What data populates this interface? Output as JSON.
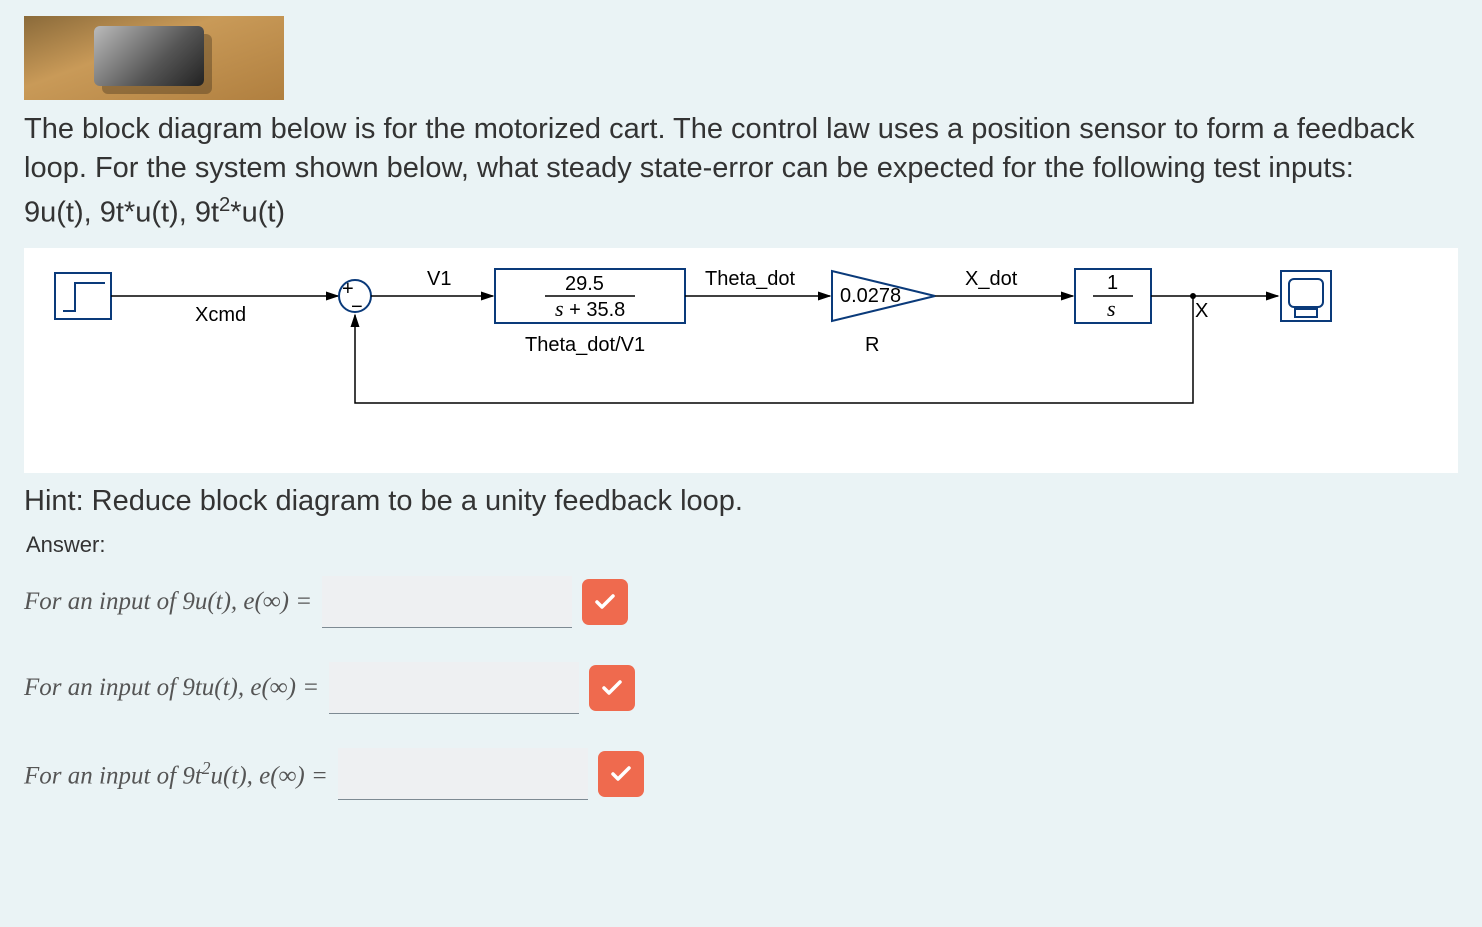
{
  "thumbnail_alt": "motorized-cart-photo",
  "problem": {
    "para": "The block diagram below is for the motorized cart.  The control law uses a position sensor to form a feedback loop.  For the system shown below, what steady state-error can be expected for the following test inputs:",
    "inputs_prefix": "9u(t), 9t*u(t), 9t",
    "inputs_exp": "2",
    "inputs_suffix": "*u(t)"
  },
  "diagram": {
    "signal_xcmd": "Xcmd",
    "signal_v1": "V1",
    "block1_label": "Theta_dot/V1",
    "block1_num": "29.5",
    "block1_den_prefix": "s",
    "block1_den_rest": " + 35.8",
    "signal_theta_dot": "Theta_dot",
    "gain_value": "0.0278",
    "gain_label": "R",
    "signal_xdot": "X_dot",
    "integrator_num": "1",
    "integrator_den": "s",
    "signal_x": "X",
    "sum_plus": "+",
    "sum_minus": "−"
  },
  "hint": "Hint: Reduce block diagram to be a unity feedback loop.",
  "answer_header": "Answer:",
  "questions": [
    {
      "prompt_pre": "For an input of 9u(t), e(∞) =",
      "value": ""
    },
    {
      "prompt_pre": "For an input of 9tu(t), e(∞) =",
      "value": ""
    },
    {
      "prompt_html_pre": "For an input of 9t",
      "prompt_exp": "2",
      "prompt_post": "u(t), e(∞) =",
      "value": ""
    }
  ]
}
